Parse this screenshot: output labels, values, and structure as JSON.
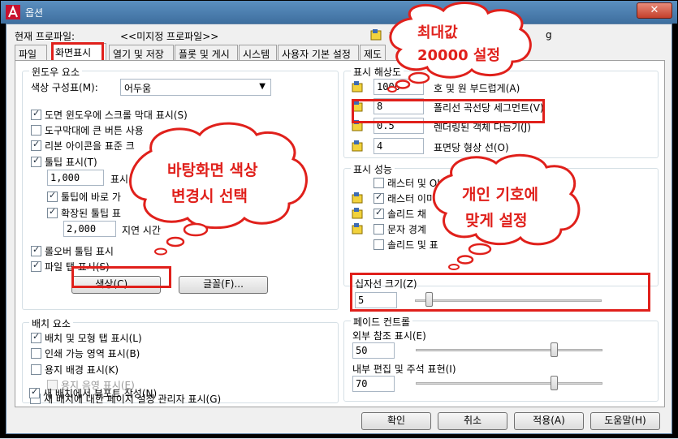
{
  "window": {
    "title": "옵션",
    "close": "✕"
  },
  "profile": {
    "label": "현재 프로파일:",
    "value": "<<미지정 프로파일>>",
    "drawing_prefix": "현",
    "drawing_ext": "g"
  },
  "tabs": [
    {
      "label": "파일"
    },
    {
      "label": "화면표시"
    },
    {
      "label": "열기 및 저장"
    },
    {
      "label": "플롯 및 게시"
    },
    {
      "label": "시스템"
    },
    {
      "label": "사용자 기본 설정"
    },
    {
      "label": "제도"
    }
  ],
  "window_elements": {
    "title": "윈도우 요소",
    "color_scheme_label": "색상 구성표(M):",
    "color_scheme_value": "어두움",
    "options": [
      {
        "label": "도면 윈도우에 스크롤 막대 표시(S)",
        "checked": true
      },
      {
        "label": "도구막대에 큰 버튼 사용",
        "checked": false
      },
      {
        "label": "리본 아이콘을 표준 크",
        "checked": true
      },
      {
        "label": "툴팁 표시(T)",
        "checked": true
      }
    ],
    "tooltip_delay_value": "1,000",
    "tooltip_delay_label": "표시",
    "sub_options": [
      {
        "label": "툴팁에 바로 가",
        "checked": true
      },
      {
        "label": "확장된 툴팁 표",
        "checked": true
      }
    ],
    "delay_value": "2,000",
    "delay_label": "지연 시간",
    "more_options": [
      {
        "label": "롤오버 툴팁 표시",
        "checked": true
      },
      {
        "label": "파일 탭 표시(S)",
        "checked": true
      }
    ],
    "colors_button": "색상(C)...",
    "fonts_button": "글꼴(F)..."
  },
  "layout_elements": {
    "title": "배치 요소",
    "options": [
      {
        "label": "배치 및 모형 탭 표시(L)",
        "checked": true,
        "disabled": false
      },
      {
        "label": "인쇄 가능 영역 표시(B)",
        "checked": false,
        "disabled": false
      },
      {
        "label": "용지 배경 표시(K)",
        "checked": false,
        "disabled": false
      },
      {
        "label": "용지 음영 표시(E)",
        "checked": false,
        "disabled": true
      },
      {
        "label": "새 배치에 대한 페이지 설정 관리자 표시(G)",
        "checked": false,
        "disabled": false
      },
      {
        "label": "새 배치에서 뷰포트 작성(N)",
        "checked": true,
        "disabled": false
      }
    ]
  },
  "display_resolution": {
    "title": "표시 해상도",
    "rows": [
      {
        "value": "1000",
        "label": "호 및 원 부드럽게(A)"
      },
      {
        "value": "8",
        "label": "폴리선 곡선당 세그먼트(V)"
      },
      {
        "value": "0.5",
        "label": "렌더링된 객체 다듬기(J)"
      },
      {
        "value": "4",
        "label": "표면당 형상 선(O)"
      }
    ]
  },
  "display_performance": {
    "title": "표시 성능",
    "options": [
      {
        "label": "래스터 및 OLE",
        "checked": false
      },
      {
        "label": "래스터 이미",
        "checked": true
      },
      {
        "label": "솔리드 채",
        "checked": true
      },
      {
        "label": "문자 경계",
        "checked": false
      },
      {
        "label": "솔리드 및 표",
        "checked": false
      }
    ]
  },
  "crosshair": {
    "label": "십자선 크기(Z)",
    "value": "5",
    "level": 5
  },
  "fade": {
    "title": "페이드 컨트롤",
    "xref_label": "외부 참조 표시(E)",
    "xref_value": "50",
    "inplace_label": "내부 편집 및 주석 표현(I)",
    "inplace_value": "70"
  },
  "footer": {
    "ok": "확인",
    "cancel": "취소",
    "apply": "적용(A)",
    "help": "도움말(H)"
  },
  "callouts": {
    "max": [
      "최대값",
      "20000 설정"
    ],
    "background": [
      "바탕화면 색상",
      "변경시 선택"
    ],
    "personal": [
      "개인 기호에",
      "맞게 설정"
    ]
  },
  "colors": {
    "annotation": "#e0201b",
    "titlebar": "#3e6f9f"
  }
}
